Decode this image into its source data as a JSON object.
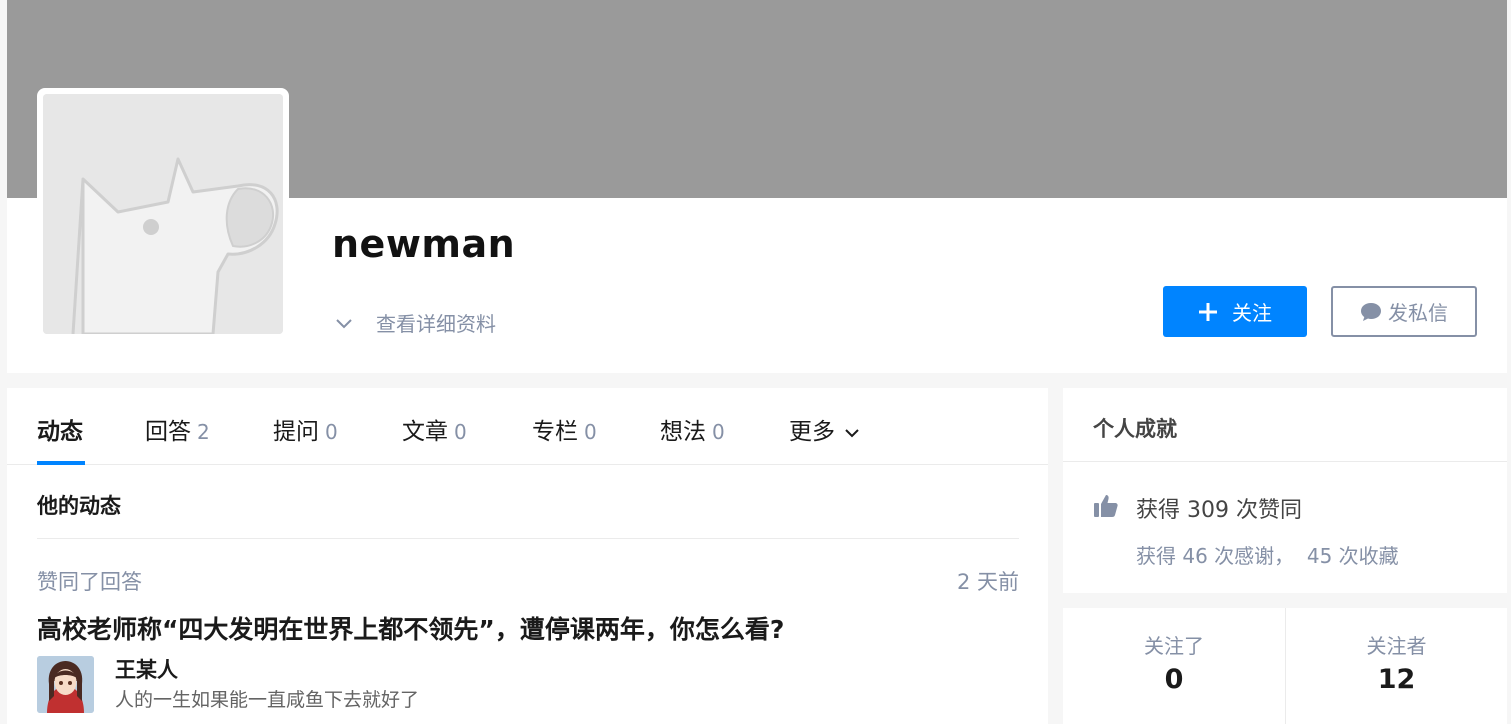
{
  "profile": {
    "username": "newman",
    "detail_link": "查看详细资料",
    "follow_button": "关注",
    "message_button": "发私信",
    "cover_color": "#9a9a9a"
  },
  "tabs": [
    {
      "label": "动态",
      "count": "",
      "active": true
    },
    {
      "label": "回答",
      "count": "2"
    },
    {
      "label": "提问",
      "count": "0"
    },
    {
      "label": "文章",
      "count": "0"
    },
    {
      "label": "专栏",
      "count": "0"
    },
    {
      "label": "想法",
      "count": "0"
    },
    {
      "label": "更多",
      "count": ""
    }
  ],
  "feed": {
    "section_title": "他的动态",
    "items": [
      {
        "type": "赞同了回答",
        "time": "2 天前",
        "question": "高校老师称“四大发明在世界上都不领先”，遭停课两年，你怎么看?",
        "author_name": "王某人",
        "author_bio": "人的一生如果能一直咸鱼下去就好了"
      }
    ]
  },
  "achievements": {
    "title": "个人成就",
    "likes_text": "获得 309 次赞同",
    "sub_text": "获得 46 次感谢，  45 次收藏"
  },
  "follow_stats": {
    "following_label": "关注了",
    "following_count": "0",
    "followers_label": "关注者",
    "followers_count": "12"
  },
  "colors": {
    "accent": "#0084ff",
    "muted": "#8590a6",
    "background": "#f6f6f6"
  }
}
